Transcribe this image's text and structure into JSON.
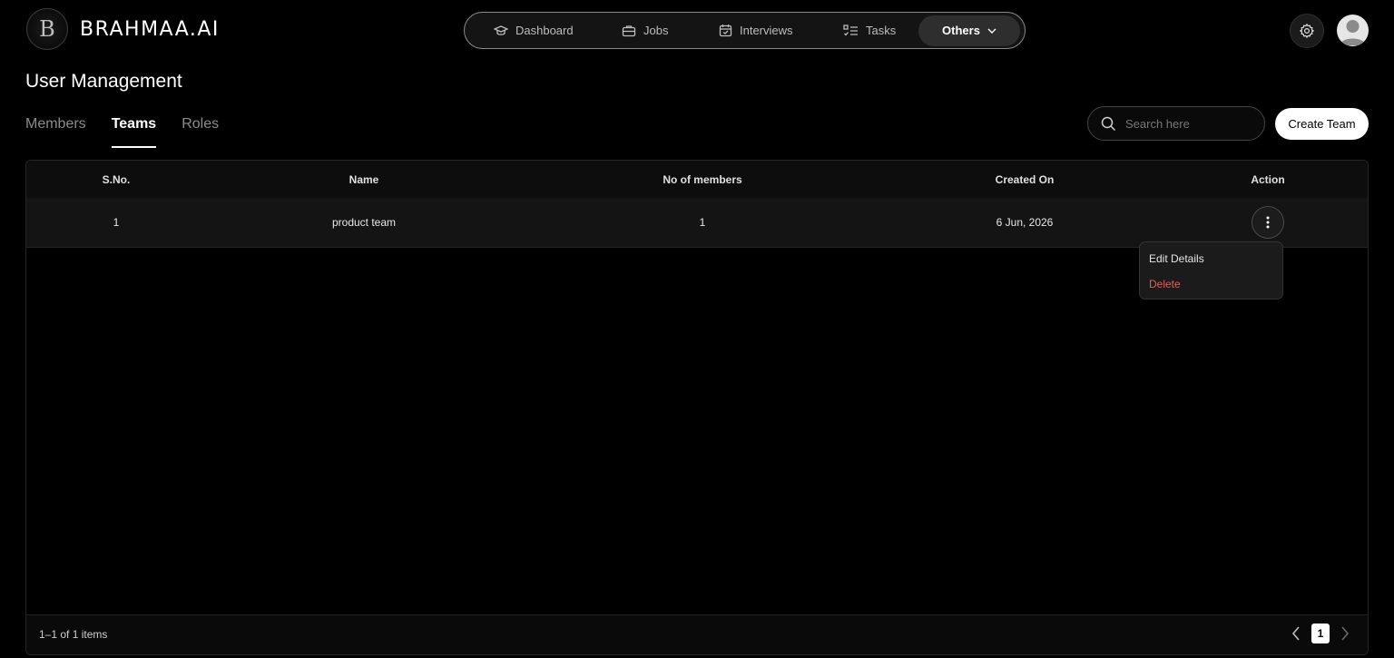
{
  "brand": {
    "logo_letter": "B",
    "name": "BRAHMAA.AI"
  },
  "nav": {
    "items": [
      {
        "label": "Dashboard",
        "icon": "graduation-cap-icon"
      },
      {
        "label": "Jobs",
        "icon": "briefcase-icon"
      },
      {
        "label": "Interviews",
        "icon": "calendar-check-icon"
      },
      {
        "label": "Tasks",
        "icon": "checklist-icon"
      },
      {
        "label": "Others",
        "icon": "chevron-down-icon"
      }
    ]
  },
  "header": {
    "settings_icon": "gear-icon",
    "avatar_icon": "user-avatar-icon"
  },
  "page": {
    "title": "User Management"
  },
  "tabs": [
    {
      "label": "Members",
      "active": false
    },
    {
      "label": "Teams",
      "active": true
    },
    {
      "label": "Roles",
      "active": false
    }
  ],
  "search": {
    "placeholder": "Search here",
    "value": ""
  },
  "actions": {
    "create_label": "Create Team"
  },
  "table": {
    "columns": [
      "S.No.",
      "Name",
      "No of members",
      "Created On",
      "Action"
    ],
    "rows": [
      {
        "sno": "1",
        "name": "product team",
        "members": "1",
        "created": "6 Jun, 2026"
      }
    ]
  },
  "row_menu": {
    "edit_label": "Edit Details",
    "delete_label": "Delete"
  },
  "pagination": {
    "summary": "1–1 of 1 items",
    "current_page": "1"
  },
  "colors": {
    "background": "#000000",
    "danger": "#f25757",
    "accent": "#ffffff"
  }
}
